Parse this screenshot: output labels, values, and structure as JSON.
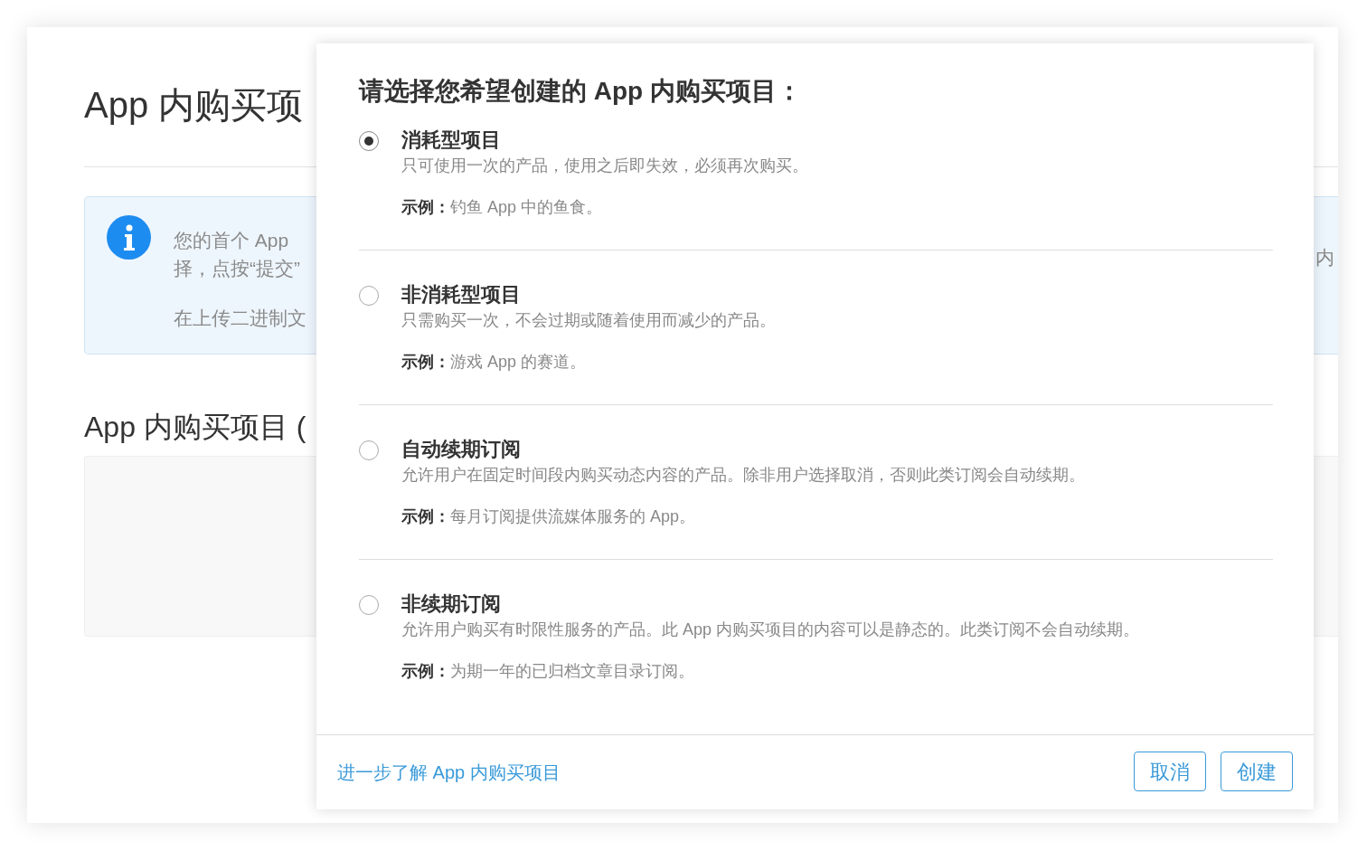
{
  "page": {
    "title": "App 内购买项",
    "info": {
      "lines": [
        "您的首个 App",
        "择，点按“提交”",
        "在上传二进制文"
      ],
      "right_fragment": "内"
    },
    "section_title": "App 内购买项目 ("
  },
  "dialog": {
    "title": "请选择您希望创建的 App 内购买项目：",
    "options": [
      {
        "title": "消耗型项目",
        "description": "只可使用一次的产品，使用之后即失效，必须再次购买。",
        "example": "**示例：**钓鱼 App 中的鱼食。",
        "selected": true
      },
      {
        "title": "非消耗型项目",
        "description": "只需购买一次，不会过期或随着使用而减少的产品。",
        "example": "**示例：**游戏 App 的赛道。",
        "selected": false
      },
      {
        "title": "自动续期订阅",
        "description": "允许用户在固定时间段内购买动态内容的产品。除非用户选择取消，否则此类订阅会自动续期。",
        "example": "**示例：**每月订阅提供流媒体服务的 App。",
        "selected": false
      },
      {
        "title": "非续期订阅",
        "description": "允许用户购买有时限性服务的产品。此 App 内购买项目的内容可以是静态的。此类订阅不会自动续期。",
        "example": "**示例：**为期一年的已归档文章目录订阅。",
        "selected": false
      }
    ],
    "learn_more": "进一步了解 App 内购买项目",
    "buttons": [
      "取消",
      "创建"
    ]
  }
}
